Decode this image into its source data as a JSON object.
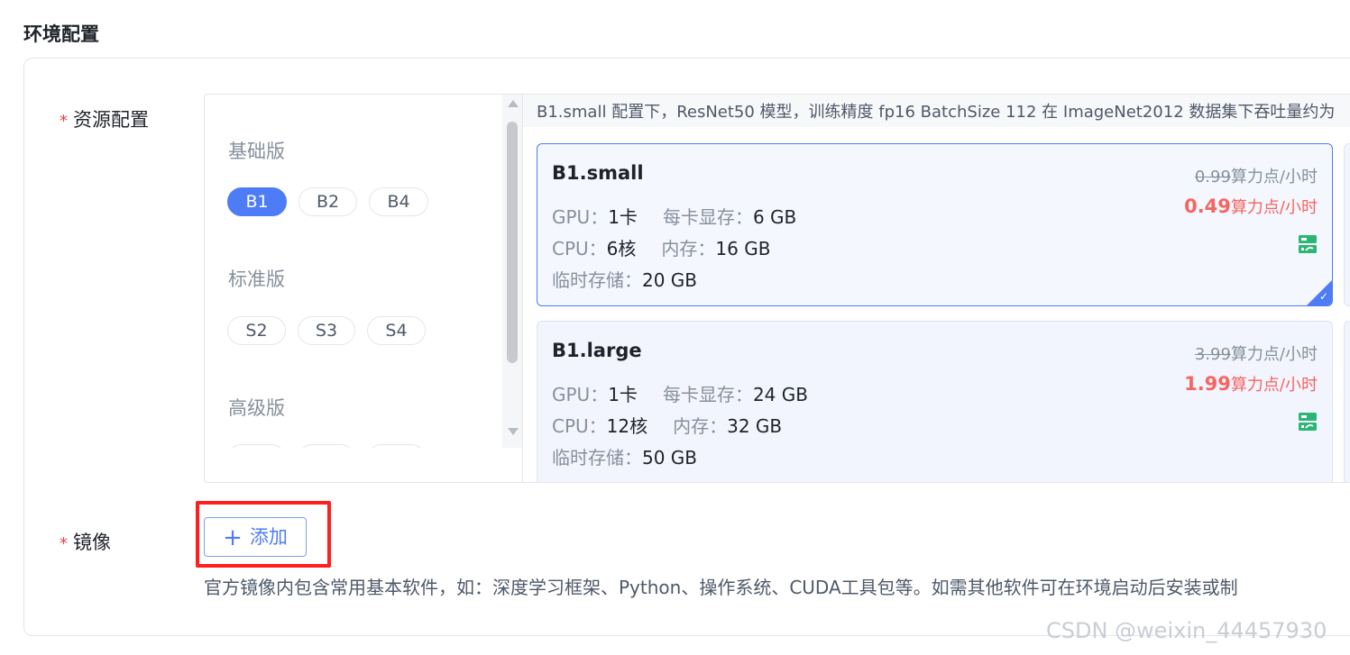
{
  "section": {
    "title": "环境配置"
  },
  "resource": {
    "label": "资源配置",
    "required_mark": "*",
    "tiers": [
      {
        "title": "基础版",
        "chips": [
          "B1",
          "B2",
          "B4"
        ],
        "active": "B1"
      },
      {
        "title": "标准版",
        "chips": [
          "S2",
          "S3",
          "S4"
        ]
      },
      {
        "title": "高级版"
      }
    ],
    "note": "B1.small 配置下，ResNet50 模型，训练精度 fp16 BatchSize 112 在 ImageNet2012 数据集下吞吐量约为",
    "cards": [
      {
        "name": "B1.small",
        "gpu_label": "GPU：",
        "gpu": "1卡",
        "vram_label": "每卡显存：",
        "vram": "6 GB",
        "cpu_label": "CPU：",
        "cpu": "6核",
        "mem_label": "内存：",
        "mem": "16 GB",
        "storage_label": "临时存储：",
        "storage": "20 GB",
        "old_price": "0.99",
        "new_price": "0.49",
        "unit": "算力点/小时",
        "selected": true
      },
      {
        "name": "B1.large",
        "gpu_label": "GPU：",
        "gpu": "1卡",
        "vram_label": "每卡显存：",
        "vram": "24 GB",
        "cpu_label": "CPU：",
        "cpu": "12核",
        "mem_label": "内存：",
        "mem": "32 GB",
        "storage_label": "临时存储：",
        "storage": "50 GB",
        "old_price": "3.99",
        "new_price": "1.99",
        "unit": "算力点/小时",
        "selected": false
      }
    ],
    "icons": {
      "server": "server-icon",
      "check": "check-icon"
    },
    "colors": {
      "accent": "#4e7cf6",
      "price": "#f76560",
      "server_icon": "#2bb673"
    }
  },
  "image": {
    "label": "镜像",
    "required_mark": "*",
    "add_button": "添加",
    "help": "官方镜像内包含常用基本软件，如：深度学习框架、Python、操作系统、CUDA工具包等。如需其他软件可在环境启动后安装或制"
  },
  "watermark": "CSDN @weixin_44457930"
}
